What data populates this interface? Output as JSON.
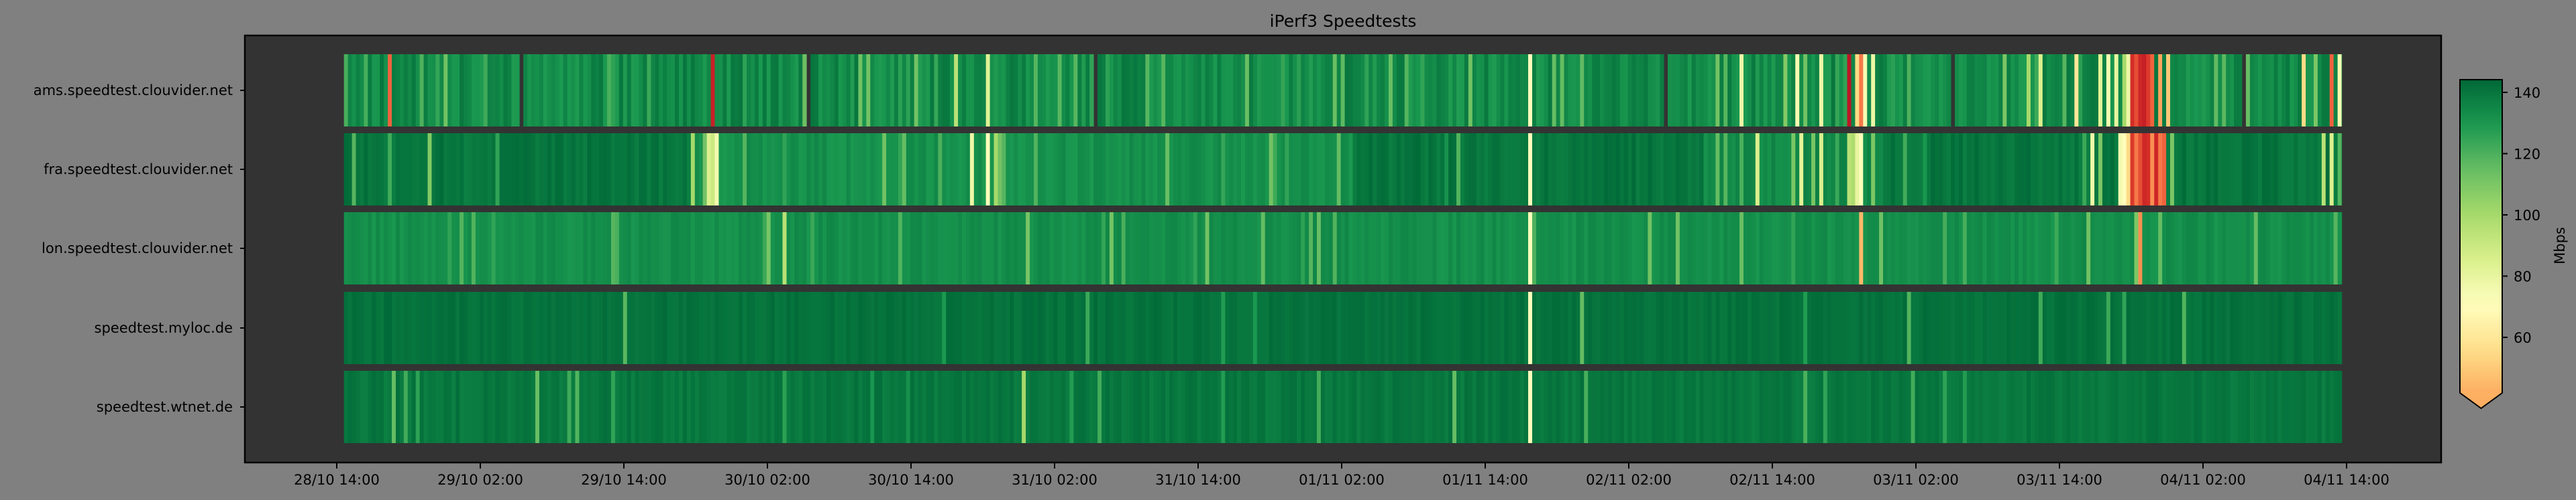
{
  "chart_data": {
    "type": "heatmap",
    "title": "iPerf3 Speedtests",
    "xlabel": "",
    "ylabel": "",
    "colorbar": {
      "label": "Mbps",
      "ticks": [
        60,
        80,
        100,
        120,
        140
      ],
      "range": [
        42,
        144
      ],
      "extend": "min",
      "colormap": "RdYlGn"
    },
    "colormap_stops": [
      "#a50026",
      "#d73027",
      "#f46d43",
      "#fdae61",
      "#fee08b",
      "#ffffbf",
      "#d9ef8b",
      "#a6d96a",
      "#66bd63",
      "#1a9850",
      "#006837"
    ],
    "axes_background": "#333333",
    "figure_background": "#808080",
    "x_unit": "hours since 28/10 14:00",
    "x_range_hours": [
      -7.7,
      175.9
    ],
    "sample_start_hours": 0.6,
    "sample_end_hours": 167.6,
    "sample_step_hours": 0.3333,
    "x_ticks": [
      {
        "h": 0,
        "label": "28/10 14:00"
      },
      {
        "h": 12,
        "label": "29/10 02:00"
      },
      {
        "h": 24,
        "label": "29/10 14:00"
      },
      {
        "h": 36,
        "label": "30/10 02:00"
      },
      {
        "h": 48,
        "label": "30/10 14:00"
      },
      {
        "h": 60,
        "label": "31/10 02:00"
      },
      {
        "h": 72,
        "label": "31/10 14:00"
      },
      {
        "h": 84,
        "label": "01/11 02:00"
      },
      {
        "h": 96,
        "label": "01/11 14:00"
      },
      {
        "h": 108,
        "label": "02/11 02:00"
      },
      {
        "h": 120,
        "label": "02/11 14:00"
      },
      {
        "h": 132,
        "label": "03/11 02:00"
      },
      {
        "h": 144,
        "label": "03/11 14:00"
      },
      {
        "h": 156,
        "label": "04/11 02:00"
      },
      {
        "h": 168,
        "label": "04/11 14:00"
      }
    ],
    "rows": [
      {
        "name": "ams.speedtest.clouvider.net",
        "jitter": 12,
        "spike_rate": 0.08,
        "baseline": [
          [
            0,
            168,
            140
          ]
        ],
        "missing": [
          15.1,
          39.1,
          63.1,
          111.0,
          135.0,
          159.1
        ],
        "events": [
          [
            4.1,
            25
          ],
          [
            22.5,
            120
          ],
          [
            31.3,
            8
          ],
          [
            43.7,
            112
          ],
          [
            44.4,
            112
          ],
          [
            51.7,
            95
          ],
          [
            54.3,
            83
          ],
          [
            58.1,
            118
          ],
          [
            81.4,
            128
          ],
          [
            93.6,
            128
          ],
          [
            99.7,
            72
          ],
          [
            101.7,
            115
          ],
          [
            102.3,
            115
          ],
          [
            115.1,
            112
          ],
          [
            115.8,
            118
          ],
          [
            117.4,
            78
          ],
          [
            120.9,
            108
          ],
          [
            122.0,
            75
          ],
          [
            122.7,
            112
          ],
          [
            124.0,
            78
          ],
          [
            126.4,
            5
          ],
          [
            126.8,
            55
          ],
          [
            127.3,
            30
          ],
          [
            127.7,
            75
          ],
          [
            128.3,
            78
          ],
          [
            139.3,
            110
          ],
          [
            141.4,
            100
          ],
          [
            142.3,
            85
          ],
          [
            144.3,
            118
          ],
          [
            145.4,
            60
          ],
          [
            147.1,
            82
          ],
          [
            148.0,
            75
          ],
          [
            148.7,
            80
          ],
          [
            149.2,
            100
          ],
          [
            149.6,
            78
          ],
          [
            150.0,
            12
          ],
          [
            150.3,
            20
          ],
          [
            150.7,
            10
          ],
          [
            151.0,
            8
          ],
          [
            151.3,
            15
          ],
          [
            151.7,
            25
          ],
          [
            152.1,
            40
          ],
          [
            152.4,
            35
          ],
          [
            152.8,
            50
          ],
          [
            164.4,
            55
          ],
          [
            165.3,
            110
          ],
          [
            166.7,
            25
          ],
          [
            167.3,
            75
          ]
        ]
      },
      {
        "name": "fra.speedtest.clouvider.net",
        "jitter": 6,
        "spike_rate": 0.04,
        "baseline": [
          [
            0,
            29.5,
            143
          ],
          [
            29.5,
            84.6,
            135
          ],
          [
            84.6,
            114,
            143
          ],
          [
            114,
            129,
            137
          ],
          [
            129,
            168,
            143
          ]
        ],
        "missing": [],
        "events": [
          [
            1.1,
            118
          ],
          [
            4.4,
            122
          ],
          [
            7.7,
            108
          ],
          [
            13.4,
            125
          ],
          [
            29.7,
            100
          ],
          [
            30.7,
            112
          ],
          [
            31.0,
            85
          ],
          [
            31.3,
            90
          ],
          [
            31.6,
            76
          ],
          [
            37.4,
            125
          ],
          [
            47.1,
            115
          ],
          [
            53.0,
            78
          ],
          [
            54.1,
            72
          ],
          [
            54.4,
            60
          ],
          [
            54.8,
            100
          ],
          [
            55.2,
            112
          ],
          [
            55.7,
            118
          ],
          [
            78.0,
            112
          ],
          [
            79.3,
            125
          ],
          [
            99.7,
            72
          ],
          [
            115.3,
            115
          ],
          [
            115.9,
            118
          ],
          [
            117.4,
            120
          ],
          [
            118.7,
            85
          ],
          [
            121.7,
            110
          ],
          [
            122.3,
            82
          ],
          [
            124.0,
            85
          ],
          [
            126.3,
            95
          ],
          [
            126.7,
            98
          ],
          [
            127.0,
            80
          ],
          [
            127.4,
            72
          ],
          [
            128.3,
            110
          ],
          [
            146.7,
            78
          ],
          [
            147.1,
            110
          ],
          [
            149.0,
            75
          ],
          [
            149.3,
            70
          ],
          [
            149.6,
            55
          ],
          [
            149.9,
            15
          ],
          [
            150.2,
            30
          ],
          [
            150.5,
            20
          ],
          [
            150.9,
            10
          ],
          [
            151.2,
            12
          ],
          [
            151.6,
            35
          ],
          [
            151.9,
            10
          ],
          [
            152.3,
            30
          ],
          [
            152.6,
            25
          ],
          [
            153.1,
            110
          ],
          [
            166.0,
            95
          ],
          [
            166.7,
            85
          ],
          [
            167.3,
            118
          ]
        ]
      },
      {
        "name": "lon.speedtest.clouvider.net",
        "jitter": 5,
        "spike_rate": 0.04,
        "baseline": [
          [
            0,
            168,
            135
          ]
        ],
        "missing": [],
        "events": [
          [
            9.4,
            125
          ],
          [
            12.8,
            125
          ],
          [
            22.8,
            118
          ],
          [
            37.3,
            95
          ],
          [
            71.7,
            125
          ],
          [
            77.3,
            115
          ],
          [
            80.7,
            126
          ],
          [
            99.7,
            72
          ],
          [
            121.6,
            125
          ],
          [
            127.3,
            45
          ],
          [
            150.3,
            110
          ],
          [
            150.6,
            35
          ],
          [
            152.3,
            115
          ]
        ]
      },
      {
        "name": "speedtest.myloc.de",
        "jitter": 4,
        "spike_rate": 0.02,
        "baseline": [
          [
            0,
            168,
            143
          ]
        ],
        "missing": [],
        "events": [
          [
            74.0,
            128
          ],
          [
            99.7,
            72
          ],
          [
            122.7,
            128
          ],
          [
            149.3,
            125
          ]
        ]
      },
      {
        "name": "speedtest.wtnet.de",
        "jitter": 5,
        "spike_rate": 0.04,
        "baseline": [
          [
            0,
            168,
            142
          ]
        ],
        "missing": [],
        "events": [
          [
            5.7,
            122
          ],
          [
            6.7,
            126
          ],
          [
            22.8,
            125
          ],
          [
            37.3,
            126
          ],
          [
            57.4,
            100
          ],
          [
            74.0,
            128
          ],
          [
            93.3,
            115
          ],
          [
            99.7,
            72
          ],
          [
            122.7,
            120
          ],
          [
            124.4,
            125
          ]
        ]
      }
    ]
  }
}
